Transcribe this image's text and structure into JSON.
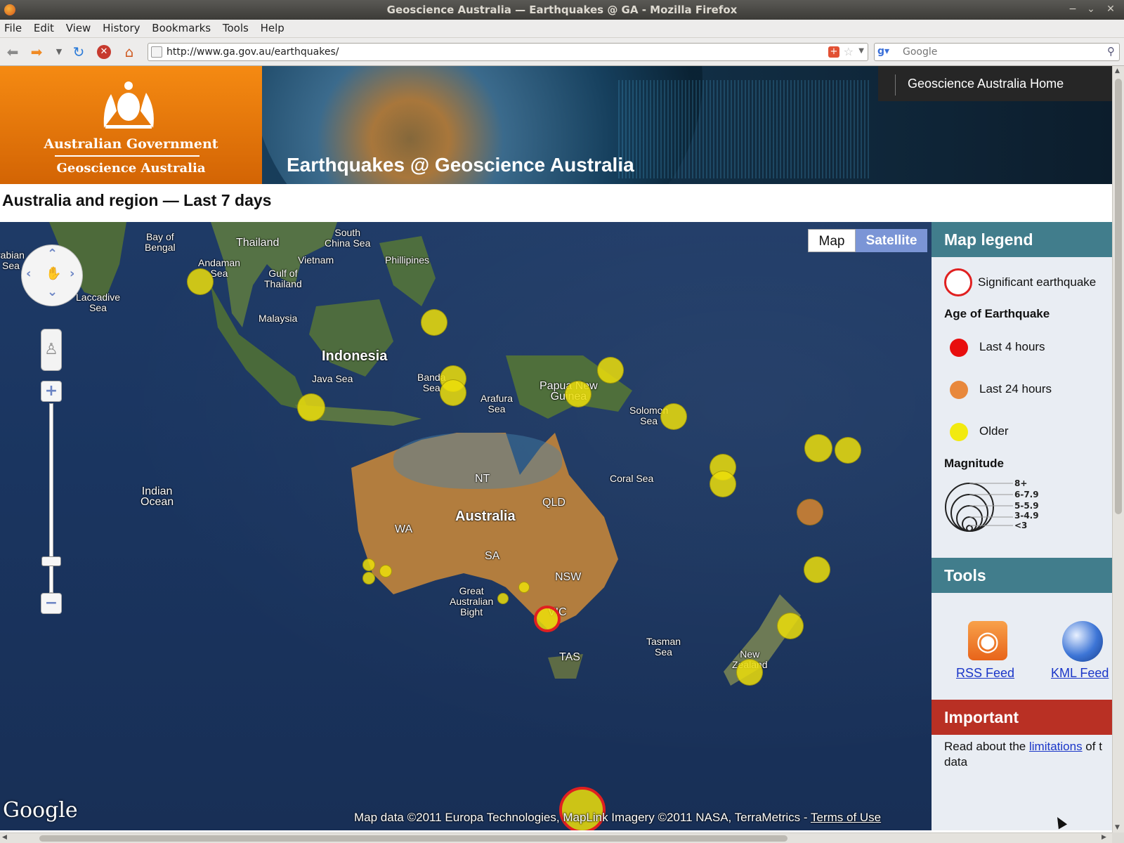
{
  "browser": {
    "window_title": "Geoscience Australia — Earthquakes @ GA - Mozilla Firefox",
    "menu": [
      "File",
      "Edit",
      "View",
      "History",
      "Bookmarks",
      "Tools",
      "Help"
    ],
    "url": "http://www.ga.gov.au/earthquakes/",
    "search_placeholder": "Google",
    "window_buttons": [
      "−",
      "⌄",
      "✕"
    ]
  },
  "header": {
    "gov_name": "Australian Government",
    "agency": "Geoscience Australia",
    "home_link": "Geoscience Australia Home",
    "site_title": "Earthquakes @ Geoscience Australia"
  },
  "page": {
    "heading": "Australia and region — Last 7 days"
  },
  "map": {
    "type_buttons": {
      "map": "Map",
      "satellite": "Satellite",
      "selected": "Satellite"
    },
    "labels": {
      "arabian_sea": "rabian\nSea",
      "bay_of_bengal": "Bay of\nBengal",
      "thailand": "Thailand",
      "south_china_sea": "South\nChina Sea",
      "vietnam": "Vietnam",
      "philippines": "Phillipines",
      "andaman_sea": "Andaman\nSea",
      "gulf_of_thailand": "Gulf of\nThailand",
      "laccadive_sea": "Laccadive\nSea",
      "malaysia": "Malaysia",
      "indonesia": "Indonesia",
      "java_sea": "Java Sea",
      "banda_sea": "Banda\nSea",
      "arafura_sea": "Arafura\nSea",
      "png": "Papua New\nGuinea",
      "solomon_sea": "Solomon\nSea",
      "indian_ocean": "Indian\nOcean",
      "nt": "NT",
      "qld": "QLD",
      "coral_sea": "Coral Sea",
      "wa": "WA",
      "australia": "Australia",
      "sa": "SA",
      "nsw": "NSW",
      "great_australian_bight": "Great\nAustralian\nBight",
      "vic": "VIC",
      "tas": "TAS",
      "tasman_sea": "Tasman\nSea",
      "new_zealand": "New\nZealand"
    },
    "google_logo": "Google",
    "attribution": "Map data ©2011 Europa Technologies, MapLink Imagery ©2011 NASA, TerraMetrics - ",
    "terms_link": "Terms of Use",
    "earthquakes": [
      {
        "place": "Andaman Sea",
        "age": "Older",
        "significant": false
      },
      {
        "place": "Philippines south",
        "age": "Older",
        "significant": false
      },
      {
        "place": "Banda Sea",
        "age": "Older",
        "significant": false
      },
      {
        "place": "Banda Sea",
        "age": "Older",
        "significant": false
      },
      {
        "place": "Java",
        "age": "Older",
        "significant": false
      },
      {
        "place": "Papua New Guinea north",
        "age": "Older",
        "significant": false
      },
      {
        "place": "Papua New Guinea",
        "age": "Older",
        "significant": false
      },
      {
        "place": "Solomon Sea",
        "age": "Older",
        "significant": false
      },
      {
        "place": "Vanuatu",
        "age": "Older",
        "significant": false
      },
      {
        "place": "Vanuatu",
        "age": "Older",
        "significant": false
      },
      {
        "place": "Fiji",
        "age": "Older",
        "significant": false
      },
      {
        "place": "Fiji",
        "age": "Older",
        "significant": false
      },
      {
        "place": "Tonga",
        "age": "Last 24 hours",
        "significant": false
      },
      {
        "place": "Kermadec Islands",
        "age": "Older",
        "significant": false
      },
      {
        "place": "New Zealand north",
        "age": "Older",
        "significant": false
      },
      {
        "place": "New Zealand",
        "age": "Older",
        "significant": false
      },
      {
        "place": "WA",
        "age": "Older",
        "significant": false
      },
      {
        "place": "WA",
        "age": "Older",
        "significant": false
      },
      {
        "place": "WA",
        "age": "Older",
        "significant": false
      },
      {
        "place": "SA",
        "age": "Older",
        "significant": false
      },
      {
        "place": "SA",
        "age": "Older",
        "significant": false
      },
      {
        "place": "VIC",
        "age": "Older",
        "significant": true
      },
      {
        "place": "Southern Ocean",
        "age": "Older",
        "significant": true
      }
    ]
  },
  "legend": {
    "title": "Map legend",
    "significant": "Significant earthquake",
    "age_heading": "Age of Earthquake",
    "ages": [
      {
        "label": "Last 4 hours",
        "color": "#e80e0e"
      },
      {
        "label": "Last 24 hours",
        "color": "#e8883c"
      },
      {
        "label": "Older",
        "color": "#f2ea10"
      }
    ],
    "magnitude_heading": "Magnitude",
    "magnitudes": [
      "8+",
      "6-7.9",
      "5-5.9",
      "3-4.9",
      "<3"
    ]
  },
  "tools": {
    "title": "Tools",
    "rss": "RSS Feed",
    "kml": "KML Feed"
  },
  "important": {
    "title": "Important",
    "text_before": "Read about the ",
    "link": "limitations",
    "text_after": " of t",
    "text_line2": "data"
  }
}
